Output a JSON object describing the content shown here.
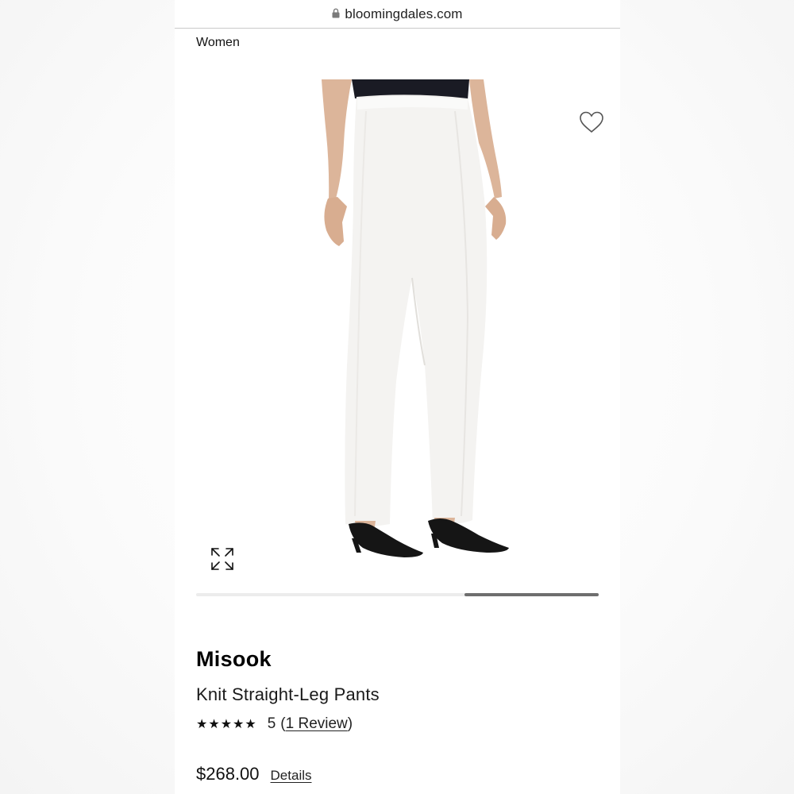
{
  "browser": {
    "url": "bloomingdales.com"
  },
  "breadcrumb": {
    "label": "Women"
  },
  "gallery": {
    "image_subject": "white knit straight-leg pants worn with black pointed heels",
    "wishlist_icon": "heart-outline-icon",
    "zoom_icon": "expand-arrows-icon",
    "carousel_position_fraction": 0.67
  },
  "product": {
    "brand": "Misook",
    "name": "Knit Straight-Leg Pants",
    "stars": "★★★★★",
    "rating_value": "5",
    "rating_open": "(",
    "review_link": "1 Review",
    "rating_close": ")",
    "price": "$268.00",
    "details_link": "Details"
  },
  "colors": {
    "page_bg": "#ffffff",
    "text": "#111111",
    "divider": "#c9c9c9",
    "scroll_thumb": "#6e6e6e"
  }
}
